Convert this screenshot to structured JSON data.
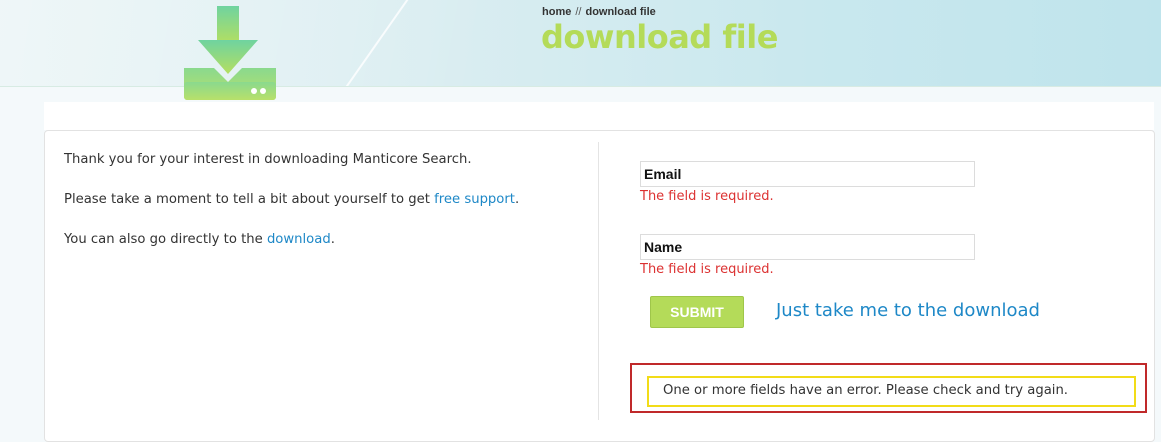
{
  "header": {
    "breadcrumb": {
      "home_label": "home",
      "separator": "//",
      "current_label": "download file"
    },
    "title": "download file",
    "logo_icon": "download-tray-icon",
    "colors": {
      "title": "#b4db59",
      "logo_gradient_top": "#6fd3a0",
      "logo_gradient_bottom": "#b5df60"
    }
  },
  "intro": {
    "line1": "Thank you for your interest in downloading Manticore Search.",
    "line2_prefix": "Please take a moment to tell a bit about yourself to get ",
    "line2_link": "free support",
    "line2_suffix": ".",
    "line3_prefix": "You can also go directly to the ",
    "line3_link": "download",
    "line3_suffix": "."
  },
  "form": {
    "email": {
      "label": "Email",
      "error": "The field is required."
    },
    "name": {
      "label": "Name",
      "error": "The field is required."
    },
    "submit_label": "SUBMIT",
    "alt_link_label": "Just take me to the download",
    "error_message": "One or more fields have an error. Please check and try again.",
    "colors": {
      "error_text": "#dc3232",
      "error_border": "#c0292a",
      "warning_border": "#f2dc18",
      "link": "#1e88c7",
      "button": "#b4db59"
    }
  }
}
